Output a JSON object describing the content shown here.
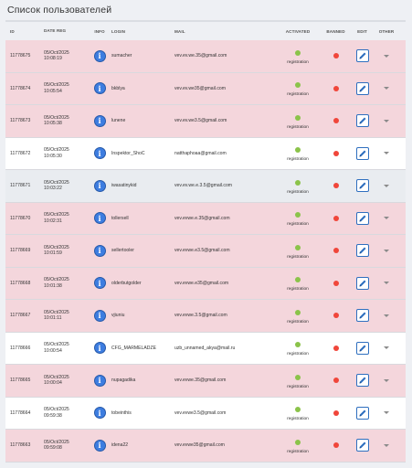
{
  "page_title": "Список пользователей",
  "columns": {
    "id": "ID",
    "date": "DATE REG",
    "info": "INFO",
    "login": "LOGIN",
    "mail": "MAIL",
    "activated": "ACTIVATED",
    "banned": "BANNED",
    "edit": "EDIT",
    "other": "OTHER"
  },
  "info_glyph": "i",
  "activated_label": "registration",
  "colors": {
    "pink_row": "#f4d6dc",
    "activated": "#8bc34a",
    "banned": "#f0463a",
    "info": "#3d7de0"
  },
  "icons": {
    "info": "info-icon",
    "activated": "green-dot-icon",
    "banned": "red-dot-icon",
    "edit": "pencil-icon",
    "other": "chevron-down-icon"
  },
  "rows": [
    {
      "id": "11778675",
      "date": "05/Oct/2025",
      "time": "10:08:19",
      "login": "sumacher",
      "mail": "vev.ev.we.35@gmail.com",
      "style": "pink"
    },
    {
      "id": "11778674",
      "date": "05/Oct/2025",
      "time": "10:05:54",
      "login": "bkblya",
      "mail": "vev.ev.we35@gmail.com",
      "style": "pink"
    },
    {
      "id": "11778673",
      "date": "05/Oct/2025",
      "time": "10:05:38",
      "login": "lunene",
      "mail": "vev.ev.we3.5@gmail.com",
      "style": "pink"
    },
    {
      "id": "11778672",
      "date": "05/Oct/2025",
      "time": "10:05:30",
      "login": "Inspektor_ShoC",
      "mail": "natthaphoaa@gmail.com",
      "style": "white"
    },
    {
      "id": "11778671",
      "date": "05/Oct/2025",
      "time": "10:03:22",
      "login": "iwasatinykid",
      "mail": "vev.ev.we.e.3.5@gmail.com",
      "style": "gray"
    },
    {
      "id": "11778670",
      "date": "05/Oct/2025",
      "time": "10:02:31",
      "login": "tollersell",
      "mail": "vev.evwe.e.35@gmail.com",
      "style": "pink"
    },
    {
      "id": "11778669",
      "date": "05/Oct/2025",
      "time": "10:01:59",
      "login": "sellertooler",
      "mail": "vev.evwe.e3.5@gmail.com",
      "style": "pink"
    },
    {
      "id": "11778668",
      "date": "05/Oct/2025",
      "time": "10:01:38",
      "login": "olderbutgolder",
      "mail": "vev.evwe.e35@gmail.com",
      "style": "pink"
    },
    {
      "id": "11778667",
      "date": "05/Oct/2025",
      "time": "10:01:11",
      "login": "vjiuniu",
      "mail": "vev.evwe.3.5@gmail.com",
      "style": "pink"
    },
    {
      "id": "11778666",
      "date": "05/Oct/2025",
      "time": "10:00:54",
      "login": "CFG_MARMELADZE",
      "mail": "uzb_unnamed_akya@mail.ru",
      "style": "white"
    },
    {
      "id": "11778665",
      "date": "05/Oct/2025",
      "time": "10:00:04",
      "login": "nupagadika",
      "mail": "vev.evwe.35@gmail.com",
      "style": "pink"
    },
    {
      "id": "11778664",
      "date": "05/Oct/2025",
      "time": "09:59:38",
      "login": "tobeinthis",
      "mail": "vev.evwe3.5@gmail.com",
      "style": "white"
    },
    {
      "id": "11778663",
      "date": "05/Oct/2025",
      "time": "09:59:08",
      "login": "idena22",
      "mail": "vev.evwe35@gmail.com",
      "style": "pink"
    }
  ]
}
